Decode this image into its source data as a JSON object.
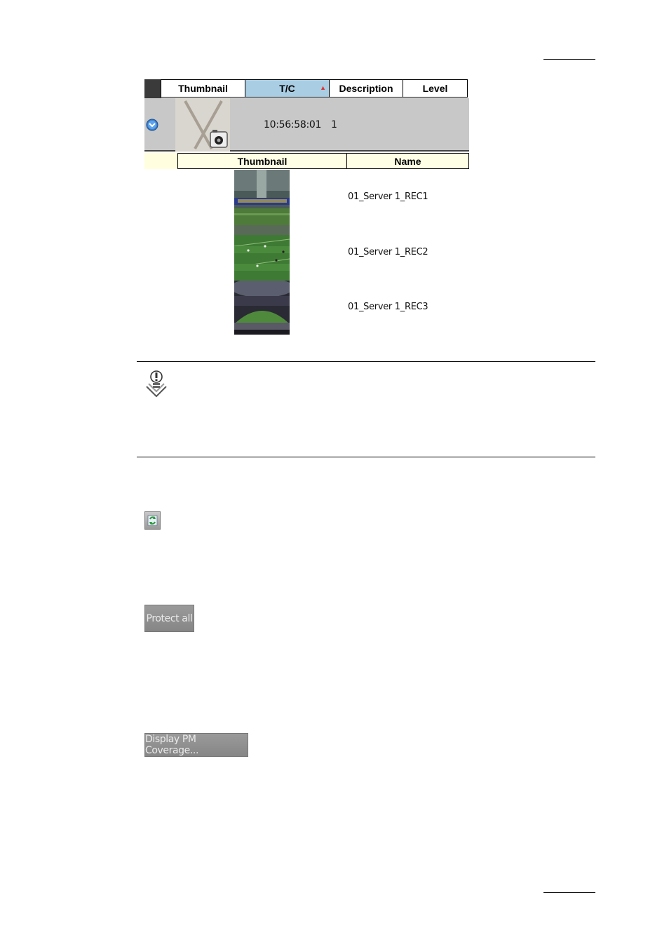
{
  "table": {
    "columns": [
      {
        "label": "Thumbnail"
      },
      {
        "label": "T/C",
        "sorted": true
      },
      {
        "label": "Description"
      },
      {
        "label": "Level"
      }
    ],
    "row": {
      "tc": "10:56:58:01",
      "level": "1"
    },
    "sub_columns": [
      {
        "label": "Thumbnail"
      },
      {
        "label": "Name"
      }
    ],
    "sub_rows": [
      {
        "name": "01_Server 1_REC1"
      },
      {
        "name": "01_Server 1_REC2"
      },
      {
        "name": "01_Server 1_REC3"
      }
    ]
  },
  "buttons": {
    "protect_all": "Protect all",
    "display_pm": "Display PM Coverage..."
  },
  "icons": {
    "expand": "expand-circle-icon",
    "no_thumbnail": "no-thumbnail-camera-icon",
    "note": "note-lightbulb-icon",
    "refresh": "refresh-icon"
  },
  "colors": {
    "header_selected": "#a9cde3",
    "row_bg": "#c8c8c8",
    "sub_header_bg": "#ffffe0",
    "button_bg": "#8f8f8f"
  }
}
